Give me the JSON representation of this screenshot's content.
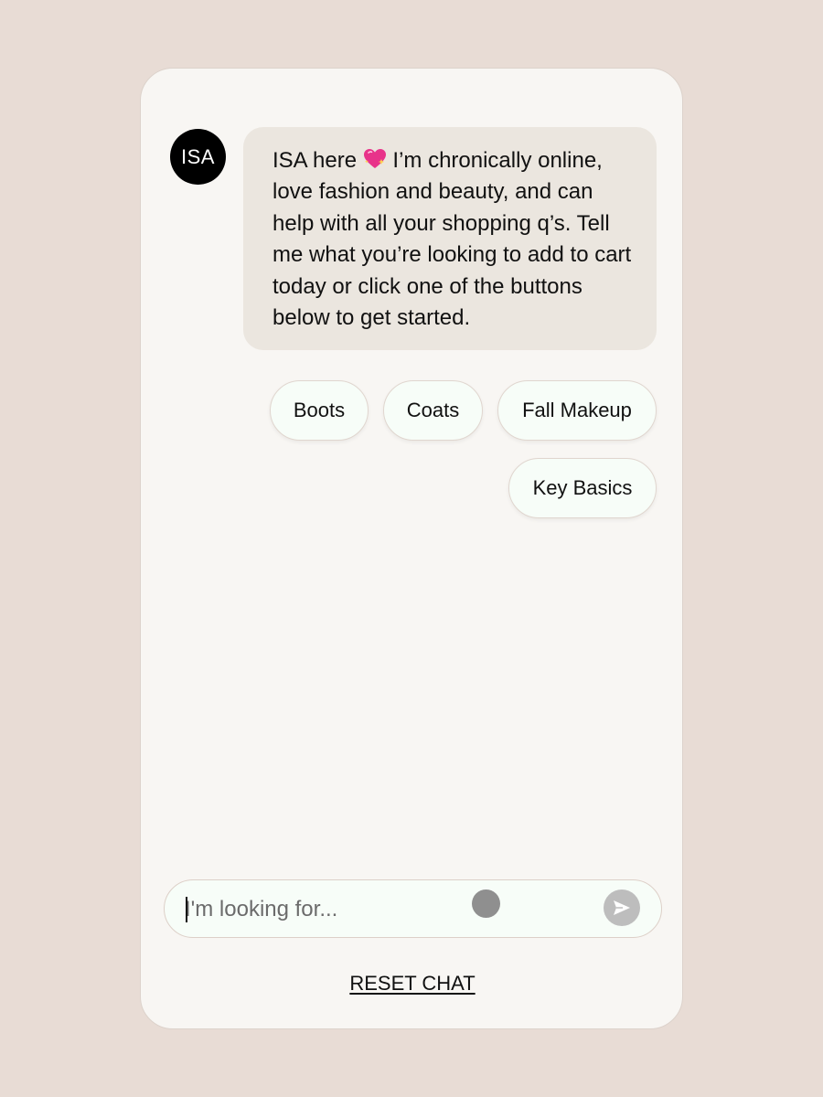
{
  "assistant": {
    "avatar_label": "ISA",
    "greeting_before_emoji": "ISA here",
    "greeting_emoji_icon": "sparkling-heart-icon",
    "greeting_after_emoji": " I’m chronically online, love fashion and beauty, and can help with all your shopping q’s. Tell me what you’re looking to add to cart today or click one of the buttons below to get started."
  },
  "quick_replies": [
    "Boots",
    "Coats",
    "Fall Makeup",
    "Key Basics"
  ],
  "composer": {
    "placeholder": "I'm looking for...",
    "value": "",
    "send_icon": "send-arrow-icon"
  },
  "footer": {
    "reset_label": "RESET CHAT"
  },
  "colors": {
    "background": "#e8dcd5",
    "card": "#f8f6f3",
    "bubble": "#ebe6df",
    "chip": "#f7fdf8",
    "avatar": "#000000",
    "send_button": "#bdbdbd",
    "emoji_heart": "#e8338a"
  }
}
